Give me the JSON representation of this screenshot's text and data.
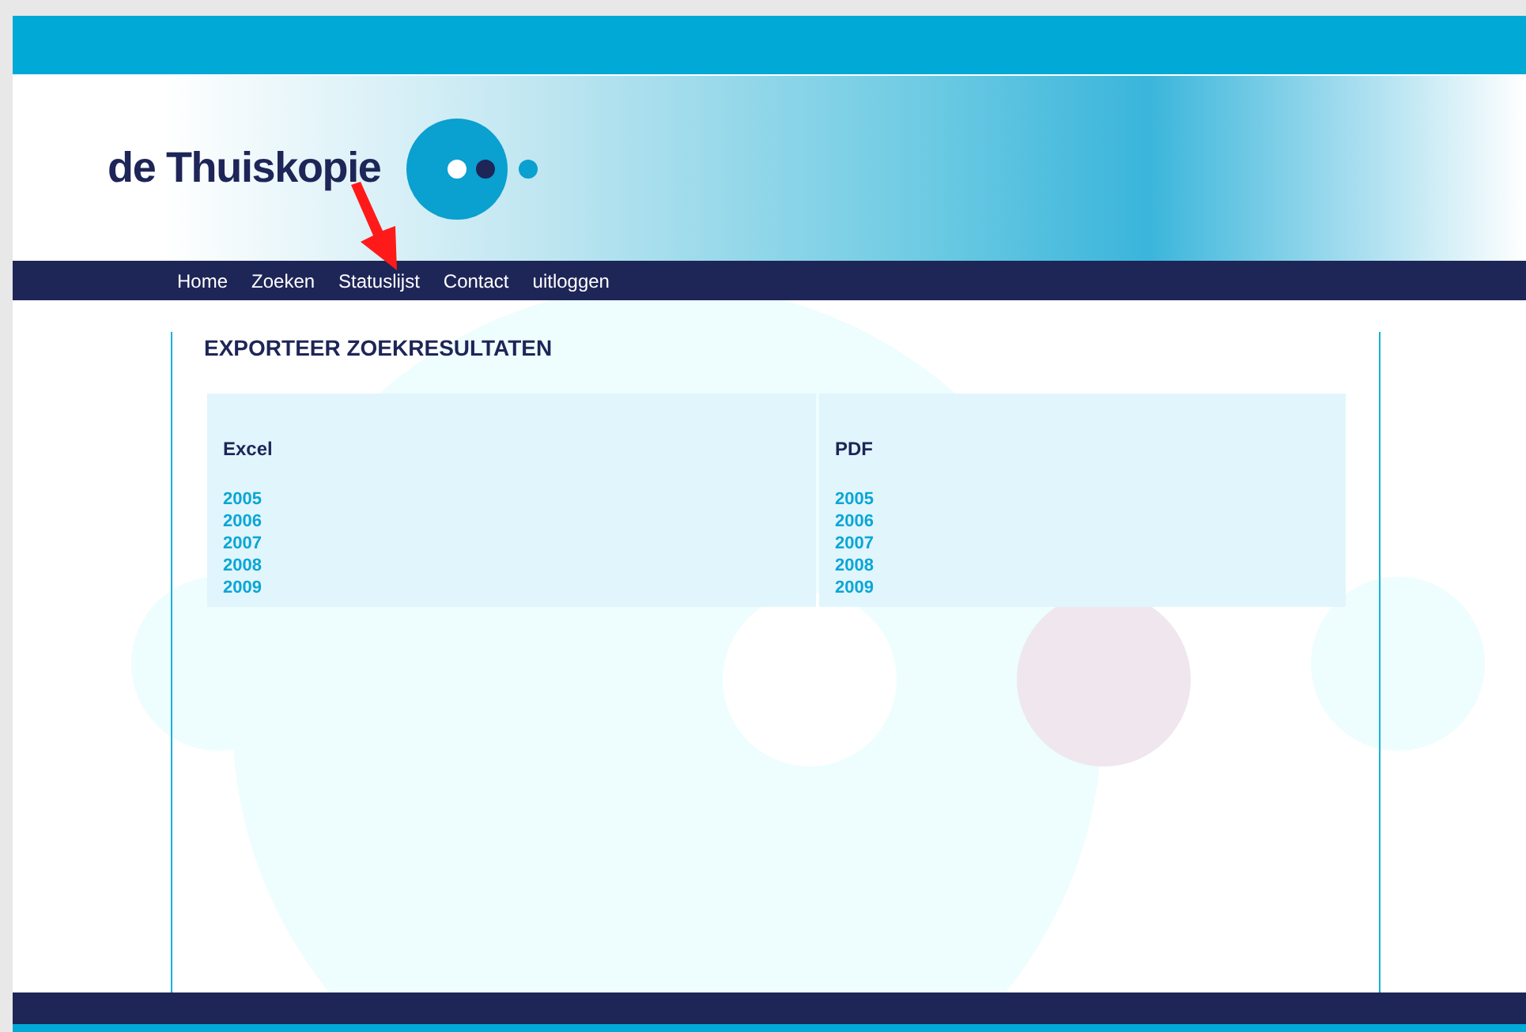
{
  "logo": {
    "text": "de Thuiskopie"
  },
  "nav": [
    {
      "label": "Home"
    },
    {
      "label": "Zoeken"
    },
    {
      "label": "Statuslijst"
    },
    {
      "label": "Contact"
    },
    {
      "label": "uitloggen"
    }
  ],
  "page_title": "EXPORTEER ZOEKRESULTATEN",
  "columns": [
    {
      "heading": "Excel",
      "links": [
        "2005",
        "2006",
        "2007",
        "2008",
        "2009"
      ]
    },
    {
      "heading": "PDF",
      "links": [
        "2005",
        "2006",
        "2007",
        "2008",
        "2009"
      ]
    }
  ]
}
